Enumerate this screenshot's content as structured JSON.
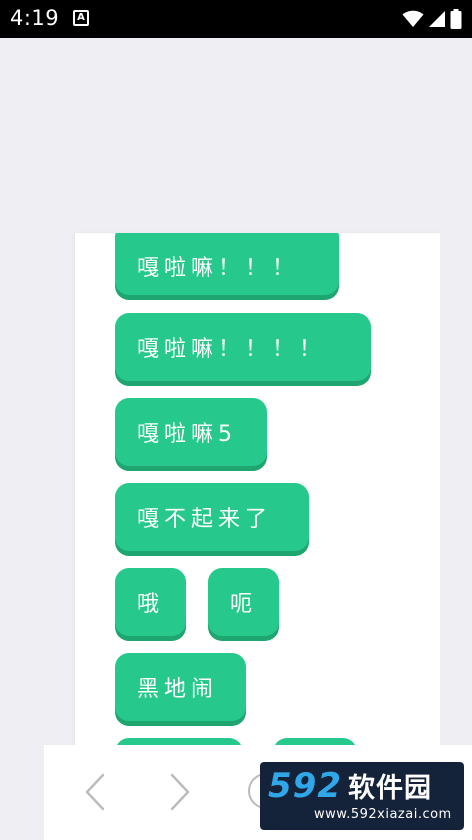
{
  "status_bar": {
    "time": "4:19",
    "notification_glyph": "A",
    "icons": [
      "wifi-icon",
      "cell-signal-icon",
      "battery-icon"
    ]
  },
  "colors": {
    "bubble": "#26c98b",
    "bubble_shadow": "#1fa570",
    "background": "#eeeef3",
    "watermark_bg": "#15233a",
    "watermark_blue": "#2fa7e8"
  },
  "bubbles": [
    {
      "text": "嘎啦嘛！！！"
    },
    {
      "text": "嘎啦嘛！！！！"
    },
    {
      "text": "嘎啦嘛5"
    },
    {
      "text": "嘎不起来了"
    },
    {
      "text": "哦"
    },
    {
      "text": "呃"
    },
    {
      "text": "黑地闹"
    }
  ],
  "nav": {
    "back_icon": "chevron-left-icon",
    "forward_icon": "chevron-right-icon"
  },
  "watermark": {
    "number": "592",
    "name": "软件园",
    "url": "www.592xiazai.com"
  }
}
